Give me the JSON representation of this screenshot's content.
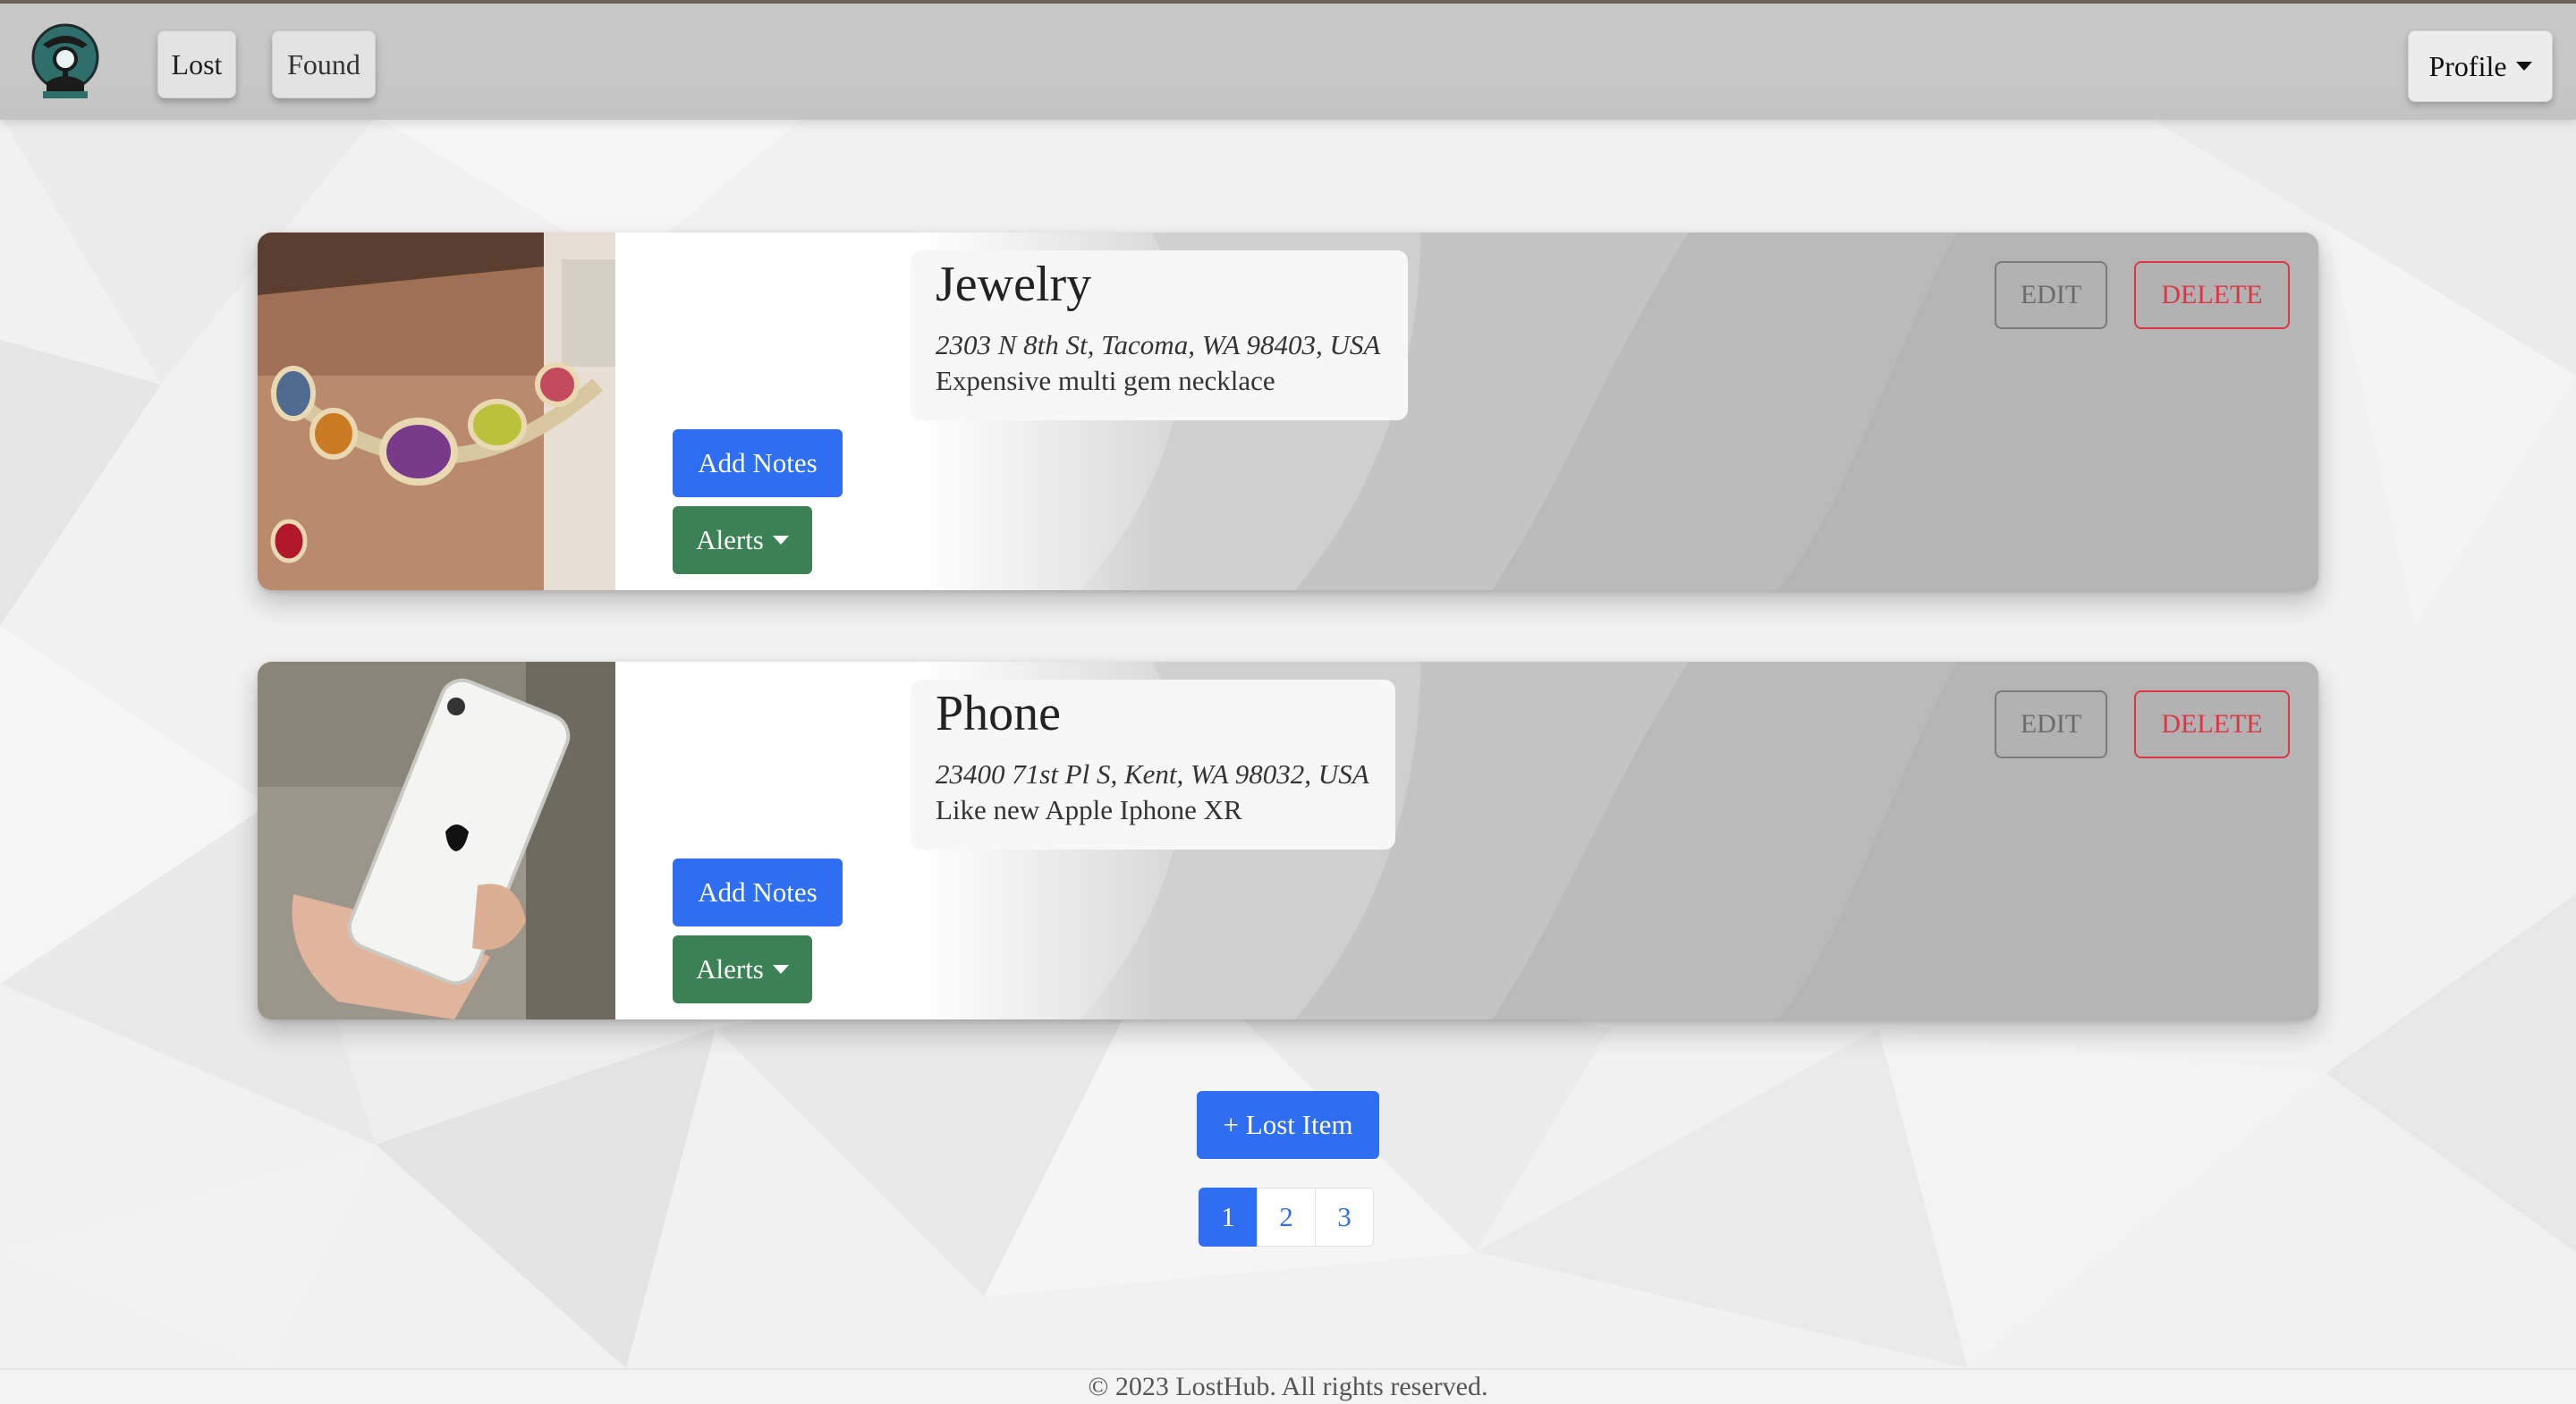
{
  "navbar": {
    "lost_label": "Lost",
    "found_label": "Found",
    "profile_label": "Profile"
  },
  "items": [
    {
      "title": "Jewelry",
      "address": "2303 N 8th St, Tacoma, WA 98403, USA",
      "description": "Expensive multi gem necklace",
      "add_notes_label": "Add Notes",
      "alerts_label": "Alerts",
      "edit_label": "EDIT",
      "delete_label": "DELETE",
      "image_icon": "necklace-photo"
    },
    {
      "title": "Phone",
      "address": "23400 71st Pl S, Kent, WA 98032, USA",
      "description": "Like new Apple Iphone XR",
      "add_notes_label": "Add Notes",
      "alerts_label": "Alerts",
      "edit_label": "EDIT",
      "delete_label": "DELETE",
      "image_icon": "iphone-photo"
    }
  ],
  "add_item_label": "+ Lost Item",
  "pagination": {
    "pages": [
      "1",
      "2",
      "3"
    ],
    "current": "1"
  },
  "footer": {
    "text": "© 2023 LostHub. All rights reserved."
  },
  "colors": {
    "primary": "#2f6ef3",
    "success": "#3c8155",
    "danger": "#dc3545",
    "navbar": "#c6c6c6"
  }
}
